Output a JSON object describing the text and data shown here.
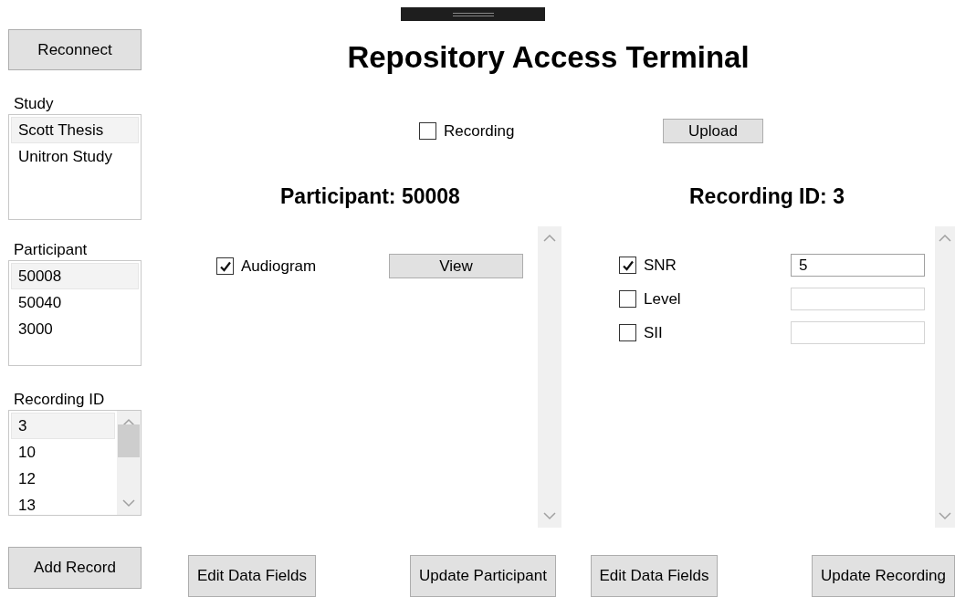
{
  "reconnect_button": "Reconnect",
  "lists": [
    {
      "label": "Study",
      "kind": "plain",
      "items": [
        {
          "text": "Scott Thesis",
          "selected": true
        },
        {
          "text": "Unitron Study",
          "selected": false
        }
      ]
    },
    {
      "label": "Participant",
      "kind": "plain",
      "items": [
        {
          "text": "50008",
          "selected": true
        },
        {
          "text": "50040",
          "selected": false
        },
        {
          "text": "3000",
          "selected": false
        }
      ]
    },
    {
      "label": "Recording ID",
      "kind": "scroll",
      "items": [
        {
          "text": "3",
          "selected": true
        },
        {
          "text": "10",
          "selected": false
        },
        {
          "text": "12",
          "selected": false
        },
        {
          "text": "13",
          "selected": false
        }
      ]
    }
  ],
  "add_record_button": "Add Record",
  "title": "Repository Access Terminal",
  "recording_checkbox": {
    "label": "Recording",
    "checked": false
  },
  "upload_button": "Upload",
  "participant_panel": {
    "heading": "Participant: 50008",
    "fields": [
      {
        "kind": "button",
        "label": "Audiogram",
        "checked": true,
        "button": "View"
      }
    ],
    "buttons": [
      "Edit Data Fields",
      "Update Participant"
    ]
  },
  "recording_panel": {
    "heading": "Recording ID: 3",
    "fields": [
      {
        "kind": "input",
        "label": "SNR",
        "checked": true,
        "value": "5"
      },
      {
        "kind": "input",
        "label": "Level",
        "checked": false
      },
      {
        "kind": "input",
        "label": "SII",
        "checked": false
      }
    ],
    "buttons": [
      "Edit Data Fields",
      "Update Recording"
    ]
  }
}
